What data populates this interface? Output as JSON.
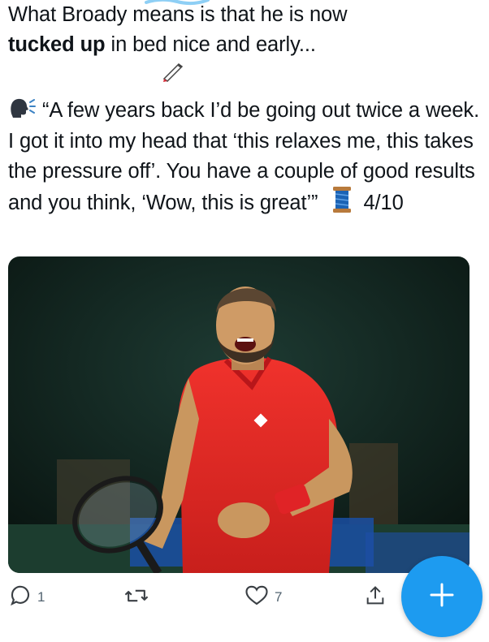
{
  "tweet": {
    "line1_prefix": "What Broady means is that he is now",
    "line2_bold": "tucked up",
    "line2_rest": " in bed nice and early...",
    "quote": "“A few years back I’d be going out twice a week. I got it into my head that ‘this relaxes me, this takes the pressure off’. You have a couple of good results and you think, ‘Wow, this is great’”",
    "thread_counter": "4/10"
  },
  "icons": {
    "pen": "pen-icon",
    "speaking_head": "speaking-head-icon",
    "thread": "thread-spool-icon"
  },
  "media": {
    "description_icon": "photo"
  },
  "actions": {
    "reply_count": "1",
    "retweet_count": "",
    "like_count": "7"
  },
  "colors": {
    "accent": "#1d9bf0",
    "muted": "#536471"
  }
}
